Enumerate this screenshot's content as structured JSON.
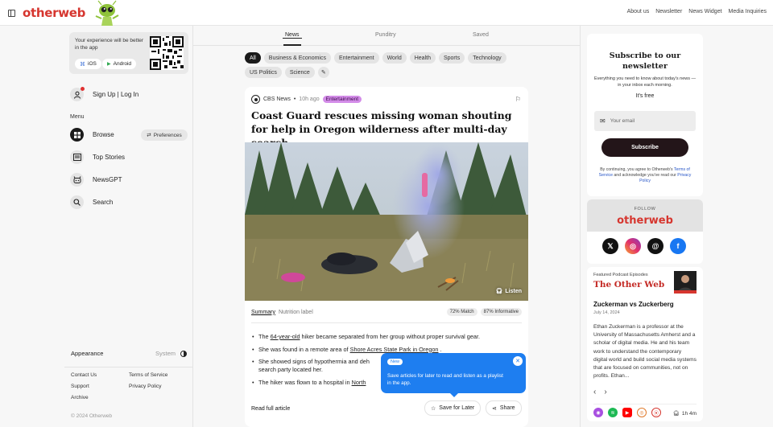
{
  "brand": {
    "logo": "otherweb",
    "accent": "#d6362f"
  },
  "top_links": [
    "About us",
    "Newsletter",
    "News Widget",
    "Media Inquiries"
  ],
  "app_promo": {
    "text": "Your experience will be better in the app",
    "ios": "iOS",
    "android": "Android"
  },
  "auth": {
    "label": "Sign Up | Log In"
  },
  "menu": {
    "heading": "Menu",
    "items": [
      "Browse",
      "Top Stories",
      "NewsGPT",
      "Search"
    ],
    "preferences": "Preferences"
  },
  "appearance": {
    "label": "Appearance",
    "value": "System"
  },
  "footer": {
    "links": [
      "Contact Us",
      "Terms of Service",
      "Support",
      "Privacy Policy",
      "Archive"
    ],
    "copyright": "© 2024 Otherweb"
  },
  "tabs": [
    "News",
    "Punditry",
    "Saved"
  ],
  "active_tab": "News",
  "categories": [
    "All",
    "Business & Economics",
    "Entertainment",
    "World",
    "Health",
    "Sports",
    "Technology",
    "US Politics",
    "Science"
  ],
  "article": {
    "source": "CBS News",
    "time": "10h ago",
    "badge": "Entertainment",
    "headline": "Coast Guard rescues missing woman shouting for help in Oregon wilderness after multi-day search",
    "listen": "Listen",
    "summary_tab": "Summary",
    "nutrition_tab": "Nutrition label",
    "match": "72% Match",
    "informative": "87% Informative",
    "bullets": [
      {
        "pre": "The ",
        "link": "64-year-old",
        "post": " hiker became separated from her group without proper survival gear."
      },
      {
        "pre": "She was found in a remote area of ",
        "link": "Shore Acres State Park in Oregon",
        "post": " ."
      },
      {
        "pre": "She showed signs of hypothermia and deh",
        "link": "",
        "post": ""
      },
      {
        "pre": "search party located her.",
        "link": "",
        "post": ""
      },
      {
        "pre": "The hiker was flown to a hospital in ",
        "link": "North",
        "post": ""
      }
    ],
    "read_full": "Read full article",
    "save": "Save for Later",
    "share": "Share"
  },
  "popup": {
    "badge": "New",
    "text": "Save articles for later to read and listen as a playlist in the app."
  },
  "newsletter": {
    "title": "Subscribe to our newsletter",
    "description": "Everything you need to know about today's news — in your inbox each morning.",
    "free": "It's free",
    "email_placeholder": "Your email",
    "button": "Subscribe",
    "legal_pre": "By continuing, you agree to Otherweb's ",
    "legal_terms": "Terms of Service",
    "legal_mid": " and acknowledge you've read our ",
    "legal_privacy": "Privacy Policy"
  },
  "follow": {
    "label": "FOLLOW",
    "logo": "otherweb",
    "networks": [
      "x-icon",
      "instagram-icon",
      "threads-icon",
      "facebook-icon"
    ]
  },
  "podcast": {
    "label": "Featured Podcast Episodes",
    "title": "The Other Web",
    "episode": "Zuckerman vs Zuckerberg",
    "date": "July 14, 2024",
    "description": "Ethan Zuckerman is a professor at the University of Massachusetts Amherst and a scholar of digital media. He and his team work to understand the contemporary digital world and build social media systems that are focused on communities, not on profits. Ethan...",
    "duration": "1h 4m"
  }
}
